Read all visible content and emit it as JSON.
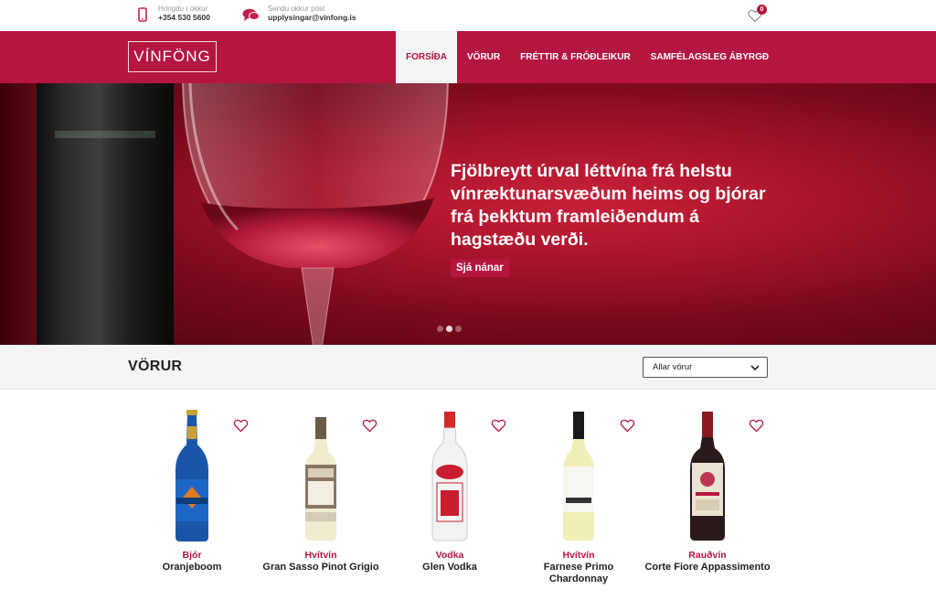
{
  "contact": {
    "phone": {
      "label": "Hringdu í okkur",
      "value": "+354 530 5600",
      "icon": "phone-icon"
    },
    "email": {
      "label": "Sendu okkur póst",
      "value": "upplysingar@vinfong.is",
      "icon": "chat-icon"
    }
  },
  "wishlist": {
    "count": "0",
    "icon": "heart-icon"
  },
  "brand": {
    "logo": "VÍNFÖNG",
    "accent": "#b5163f"
  },
  "nav": [
    {
      "label": "FORSÍÐA",
      "active": true
    },
    {
      "label": "VÖRUR",
      "active": false
    },
    {
      "label": "FRÉTTIR & FRÓÐLEIKUR",
      "active": false
    },
    {
      "label": "SAMFÉLAGSLEG ÁBYRGÐ",
      "active": false
    }
  ],
  "hero": {
    "headline": "Fjölbreytt úrval léttvína frá helstu vínræktunarsvæðum heims og bjórar frá þekktum framleiðendum á hagstæðu verði.",
    "cta": "Sjá nánar",
    "slides": 3,
    "active_slide": 2
  },
  "products_section": {
    "title": "VÖRUR",
    "filter": {
      "selected": "Allar vörur"
    }
  },
  "products": [
    {
      "category": "Bjór",
      "name": "Oranjeboom"
    },
    {
      "category": "Hvítvín",
      "name": "Gran Sasso Pinot Grigio"
    },
    {
      "category": "Vodka",
      "name": "Glen Vodka"
    },
    {
      "category": "Hvítvín",
      "name": "Farnese Primo Chardonnay"
    },
    {
      "category": "Rauðvín",
      "name": "Corte Fiore Appassimento"
    }
  ]
}
